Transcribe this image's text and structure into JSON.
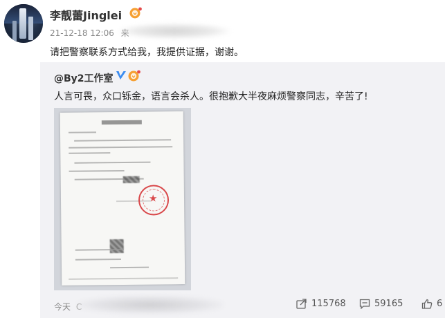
{
  "post": {
    "username": "李靓蕾Jinglei",
    "timestamp": "21-12-18 12:06",
    "source_prefix": "来",
    "text": "请把警察联系方式给我，我提供证据，谢谢。"
  },
  "repost": {
    "author": "@By2工作室",
    "text": "人言可畏，众口铄金，语言会杀人。很抱歉大半夜麻烦警察同志，辛苦了!",
    "image_icon": "police-receipt-document",
    "time_prefix": "今天",
    "time_blurred": "C",
    "counts": {
      "reposts": "115768",
      "comments": "59165",
      "likes": "6"
    }
  },
  "colors": {
    "repost_bg": "#f2f2f5",
    "badge_orange": "#f6a033",
    "verified_blue": "#3b8cf0",
    "stamp_red": "#d9484a"
  }
}
